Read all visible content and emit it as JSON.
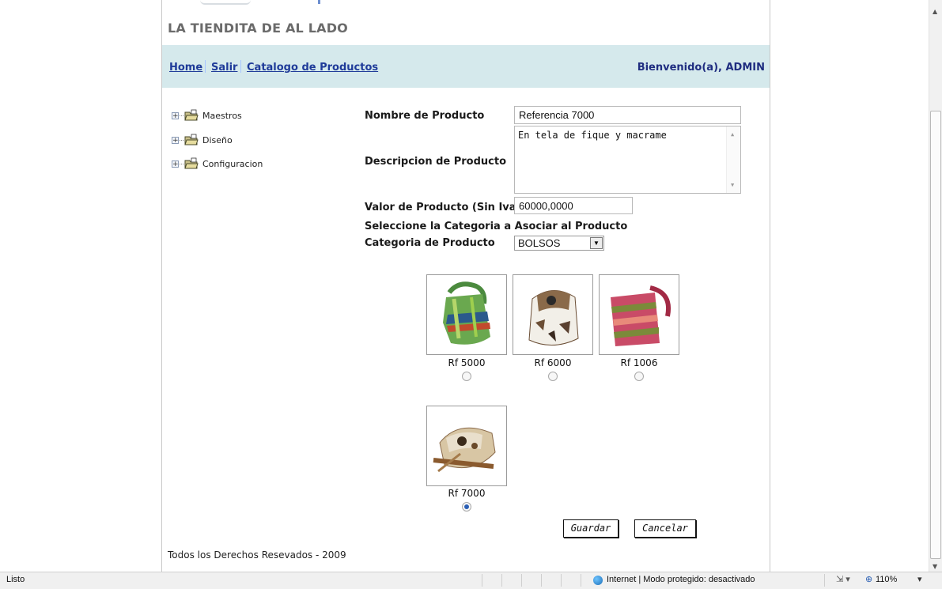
{
  "site": {
    "title": "LA TIENDITA DE AL LADO"
  },
  "nav": {
    "home": "Home",
    "salir": "Salir",
    "catalogo": "Catalogo de Productos",
    "welcome": "Bienvenido(a), ADMIN"
  },
  "tree": {
    "items": [
      {
        "label": "Maestros",
        "icon": "folder-icon"
      },
      {
        "label": "Diseño",
        "icon": "folder-icon"
      },
      {
        "label": "Configuracion",
        "icon": "folder-icon"
      }
    ]
  },
  "form": {
    "name_label": "Nombre de Producto",
    "name_value": "Referencia 7000",
    "desc_label": "Descripcion de Producto",
    "desc_value": "En tela de fique y macrame",
    "price_label": "Valor de Producto (Sin Iva)",
    "price_value": "60000,0000",
    "category_heading": "Seleccione la Categoria a Asociar al Producto",
    "category_label": "Categoria de Producto",
    "category_value": "BOLSOS"
  },
  "products": [
    {
      "ref": "Rf 5000",
      "selected": false,
      "colors": [
        "#3f7a3f",
        "#9fcf4e",
        "#2b5a8c",
        "#c24a2c"
      ]
    },
    {
      "ref": "Rf 6000",
      "selected": false,
      "colors": [
        "#ffffff",
        "#6b4e35",
        "#c9b79a",
        "#2a2a2a"
      ]
    },
    {
      "ref": "Rf 1006",
      "selected": false,
      "colors": [
        "#c94b67",
        "#7b8a3a",
        "#e88a7a",
        "#a22a45"
      ]
    },
    {
      "ref": "Rf 7000",
      "selected": true,
      "colors": [
        "#cbb392",
        "#8a5a2e",
        "#e0d4bf",
        "#6a4a2a"
      ]
    }
  ],
  "buttons": {
    "save": "Guardar",
    "cancel": "Cancelar"
  },
  "footer": {
    "text": "Todos los Derechos Resevados - 2009"
  },
  "statusbar": {
    "left": "Listo",
    "zone": "Internet | Modo protegido: desactivado",
    "zoom": "110%"
  }
}
